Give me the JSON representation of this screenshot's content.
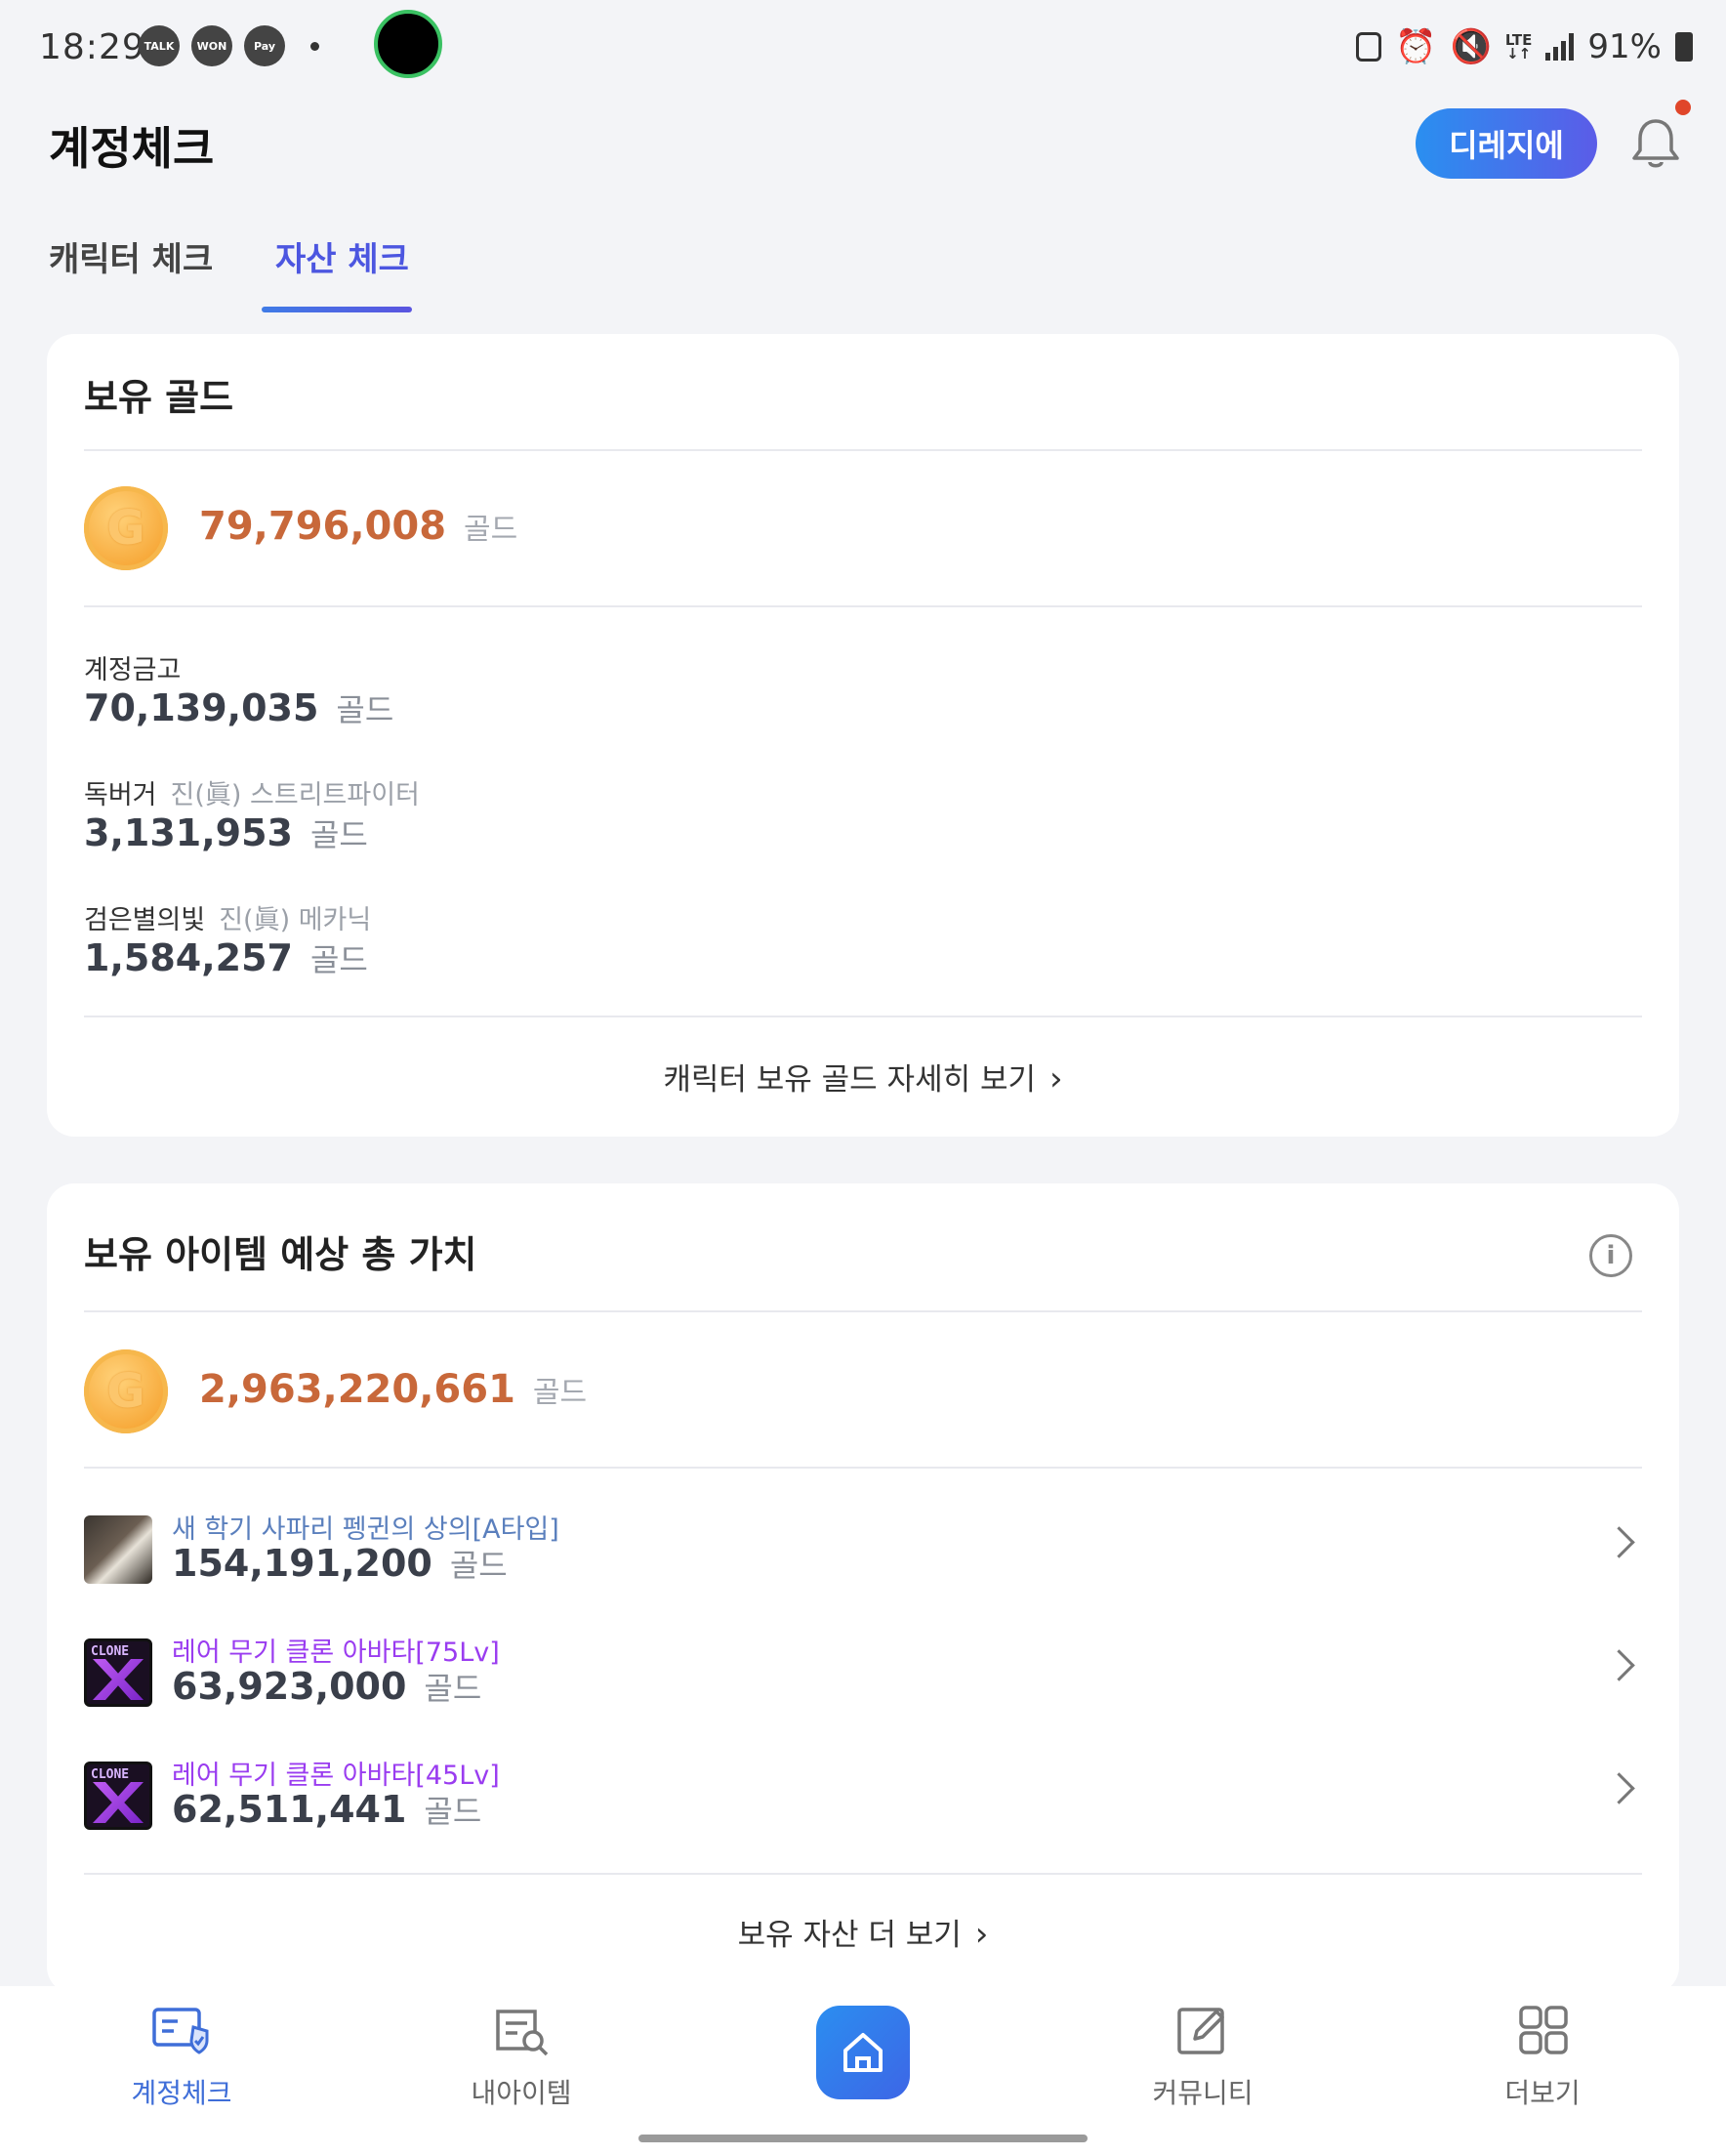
{
  "status_bar": {
    "time": "18:29",
    "left_icons": [
      "TALK",
      "WON",
      "Pay"
    ],
    "network": "LTE",
    "battery": "91%"
  },
  "header": {
    "title": "계정체크",
    "dizzy_button": "디레지에"
  },
  "tabs": [
    {
      "label": "캐릭터 체크",
      "active": false
    },
    {
      "label": "자산 체크",
      "active": true
    }
  ],
  "gold_card": {
    "title": "보유 골드",
    "total_amount": "79,796,008",
    "unit": "골드",
    "entries": [
      {
        "name": "계정금고",
        "sub": "",
        "value": "70,139,035",
        "unit": "골드"
      },
      {
        "name": "독버거",
        "sub": "진(眞) 스트리트파이터",
        "value": "3,131,953",
        "unit": "골드"
      },
      {
        "name": "검은별의빛",
        "sub": "진(眞) 메카닉",
        "value": "1,584,257",
        "unit": "골드"
      }
    ],
    "more_link": "캐릭터 보유 골드 자세히 보기"
  },
  "item_card": {
    "title": "보유 아이템 예상 총 가치",
    "total_amount": "2,963,220,661",
    "unit": "골드",
    "items": [
      {
        "name": "새 학기 사파리 펭귄의 상의[A타입]",
        "value": "154,191,200",
        "unit": "골드",
        "name_color": "#5a7fbd"
      },
      {
        "name": "레어 무기 클론 아바타[75Lv]",
        "value": "63,923,000",
        "unit": "골드",
        "name_color": "#9a3cf0"
      },
      {
        "name": "레어 무기 클론 아바타[45Lv]",
        "value": "62,511,441",
        "unit": "골드",
        "name_color": "#9a3cf0"
      }
    ],
    "clone_label": "CLONE",
    "more_link": "보유 자산 더 보기"
  },
  "bottom_nav": [
    {
      "label": "계정체크",
      "icon": "account-check-icon",
      "active": true
    },
    {
      "label": "내아이템",
      "icon": "my-item-icon",
      "active": false
    },
    {
      "label": "",
      "icon": "home-icon",
      "active": false
    },
    {
      "label": "커뮤니티",
      "icon": "community-icon",
      "active": false
    },
    {
      "label": "더보기",
      "icon": "more-grid-icon",
      "active": false
    }
  ],
  "colors": {
    "accent": "#4c56e0",
    "gold_text": "#c8683a",
    "brand_gradient_start": "#2a8ff0",
    "brand_gradient_end": "#5b5ce8"
  }
}
